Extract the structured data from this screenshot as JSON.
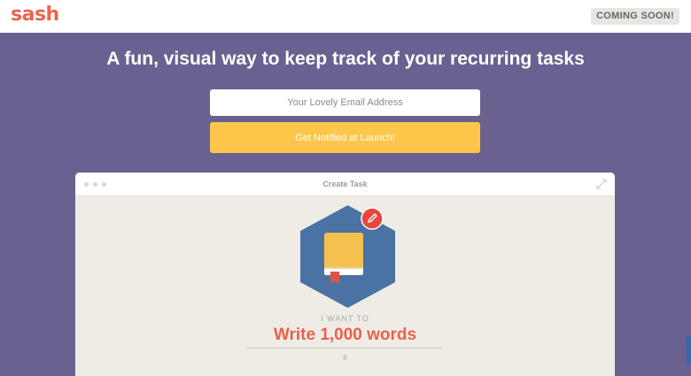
{
  "header": {
    "logo_text": "sash",
    "coming_soon_label": "COMING SOON!"
  },
  "hero": {
    "headline": "A fun, visual way to keep track of your recurring tasks",
    "email_placeholder": "Your Lovely Email Address",
    "notify_button_label": "Get Notified at Launch!"
  },
  "preview_window": {
    "title": "Create Task",
    "want_label": "I WANT TO",
    "task_name": "Write 1,000 words",
    "char_count": "8",
    "badge_icon": "book-icon",
    "edit_icon": "pencil-icon"
  },
  "colors": {
    "page_background": "#6a6190",
    "brand_coral": "#e8654f",
    "button_yellow": "#fdc64a",
    "badge_blue": "#4a72a3",
    "book_yellow": "#f5c14e"
  }
}
